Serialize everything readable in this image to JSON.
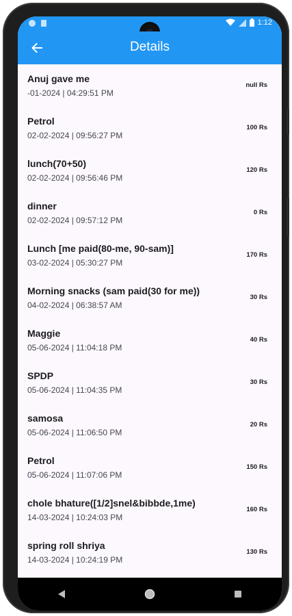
{
  "status_bar": {
    "time": "1:12",
    "icons": [
      "notification-dot-icon",
      "sim-card-icon",
      "wifi-icon",
      "signal-icon",
      "battery-icon"
    ]
  },
  "app_bar": {
    "title": "Details",
    "back_icon": "arrow-back-icon",
    "color": "#2196f3"
  },
  "transactions": [
    {
      "title": "Anuj gave me",
      "datetime": "-01-2024 | 04:29:51 PM",
      "amount": "null Rs"
    },
    {
      "title": "Petrol",
      "datetime": "02-02-2024 | 09:56:27 PM",
      "amount": "100 Rs"
    },
    {
      "title": "lunch(70+50)",
      "datetime": "02-02-2024 | 09:56:46 PM",
      "amount": "120 Rs"
    },
    {
      "title": "dinner",
      "datetime": "02-02-2024 | 09:57:12 PM",
      "amount": "0 Rs"
    },
    {
      "title": "Lunch [me paid(80-me, 90-sam)]",
      "datetime": "03-02-2024 | 05:30:27 PM",
      "amount": "170 Rs"
    },
    {
      "title": "Morning snacks (sam paid(30 for me))",
      "datetime": "04-02-2024 | 06:38:57 AM",
      "amount": "30 Rs"
    },
    {
      "title": "Maggie",
      "datetime": "05-06-2024 | 11:04:18 PM",
      "amount": "40 Rs"
    },
    {
      "title": "SPDP",
      "datetime": "05-06-2024 | 11:04:35 PM",
      "amount": "30 Rs"
    },
    {
      "title": "samosa",
      "datetime": "05-06-2024 | 11:06:50 PM",
      "amount": "20 Rs"
    },
    {
      "title": "Petrol",
      "datetime": "05-06-2024 | 11:07:06 PM",
      "amount": "150 Rs"
    },
    {
      "title": "chole bhature([1/2]snel&bibbde,1me)",
      "datetime": "14-03-2024 | 10:24:03 PM",
      "amount": "160 Rs"
    },
    {
      "title": "spring roll shriya",
      "datetime": "14-03-2024 | 10:24:19 PM",
      "amount": "130 Rs"
    }
  ],
  "nav_bar": {
    "buttons": [
      "back-triangle-icon",
      "home-circle-icon",
      "recents-square-icon"
    ]
  }
}
